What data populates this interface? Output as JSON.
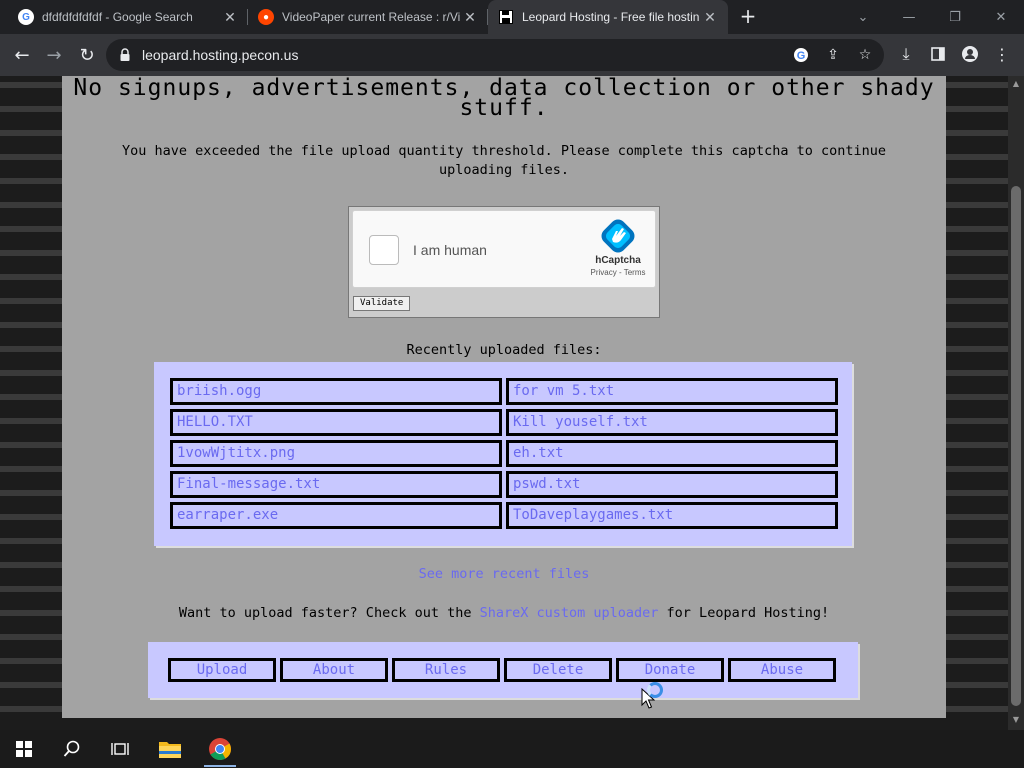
{
  "browser": {
    "tabs": [
      {
        "title": "dfdfdfdfdfdf - Google Search",
        "favicon": "google-icon"
      },
      {
        "title": "VideoPaper current Release : r/Vi",
        "favicon": "reddit-icon"
      },
      {
        "title": "Leopard Hosting - Free file hostin",
        "favicon": "floppy-disk-icon"
      }
    ],
    "url": "leopard.hosting.pecon.us"
  },
  "page": {
    "headline": "No signups, advertisements, data collection or other shady stuff.",
    "notice": "You have exceeded the file upload quantity threshold. Please complete this captcha to continue uploading files.",
    "captcha": {
      "label": "I am human",
      "brand": "hCaptcha",
      "links": "Privacy - Terms",
      "validate_label": "Validate"
    },
    "recent_label": "Recently uploaded files:",
    "files": [
      "briish.ogg",
      "for vm 5.txt",
      "HELLO.TXT",
      "Kill youself.txt",
      "1vowWjtitx.png",
      "eh.txt",
      "Final-message.txt",
      "pswd.txt",
      "earraper.exe",
      "ToDaveplaygames.txt"
    ],
    "more_link": "See more recent files",
    "sharex": {
      "prefix": "Want to upload faster? Check out the ",
      "link": "ShareX custom uploader",
      "suffix": " for Leopard Hosting!"
    },
    "nav": [
      "Upload",
      "About",
      "Rules",
      "Delete",
      "Donate",
      "Abuse"
    ]
  },
  "colors": {
    "page_bg": "#a3a3a3",
    "box_bg": "#c8c8ff",
    "link": "#6a6af0"
  }
}
